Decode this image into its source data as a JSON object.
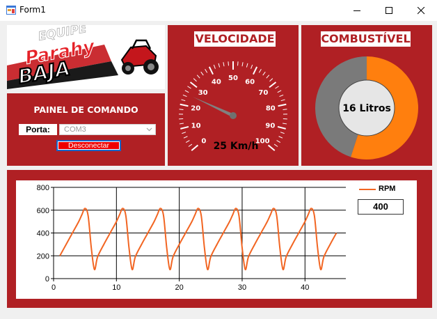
{
  "window": {
    "title": "Form1"
  },
  "logo": {
    "text_top": "EQUIPE",
    "text_main": "Parahy",
    "text_bottom": "BAJA"
  },
  "command_panel": {
    "title": "PAINEL DE COMANDO",
    "port_label": "Porta:",
    "port_value": "COM3",
    "disconnect_label": "Desconectar"
  },
  "speed_panel": {
    "title": "VELOCIDADE",
    "readout": "25 Km/h",
    "value": 25,
    "min": 0,
    "max": 100,
    "ticks": [
      "0",
      "10",
      "20",
      "30",
      "40",
      "50",
      "60",
      "70",
      "80",
      "90",
      "100"
    ]
  },
  "fuel_panel": {
    "title": "COMBUSTÍVEL",
    "readout": "16 Litros",
    "fill_fraction": 0.55,
    "fill_color": "#ff7f0e",
    "empty_color": "#7a7a7a"
  },
  "rpm_display": {
    "legend": "RPM",
    "value": "400",
    "color": "#f26522"
  },
  "chart_data": {
    "type": "line",
    "series": [
      {
        "name": "RPM",
        "x": [
          1,
          2,
          3,
          4,
          4.5,
          5,
          5.5,
          6,
          6.5,
          7,
          8,
          9,
          10,
          10.5,
          11,
          11.5,
          12,
          12.5,
          13,
          14,
          15,
          16,
          16.5,
          17,
          17.5,
          18,
          18.5,
          19,
          20,
          21,
          22,
          22.5,
          23,
          23.5,
          24,
          24.5,
          25,
          26,
          27,
          28,
          28.5,
          29,
          29.5,
          30,
          30.5,
          31,
          32,
          33,
          34,
          34.5,
          35,
          35.5,
          36,
          36.5,
          37,
          38,
          39,
          40,
          40.5,
          41,
          41.5,
          42,
          42.5,
          43,
          44,
          45
        ],
        "values": [
          200,
          300,
          400,
          500,
          560,
          615,
          550,
          270,
          80,
          190,
          300,
          400,
          500,
          560,
          615,
          550,
          270,
          80,
          190,
          300,
          400,
          500,
          560,
          615,
          550,
          270,
          80,
          190,
          300,
          400,
          500,
          560,
          615,
          550,
          270,
          80,
          190,
          300,
          400,
          500,
          560,
          615,
          550,
          270,
          80,
          190,
          300,
          400,
          500,
          560,
          615,
          550,
          270,
          80,
          190,
          300,
          400,
          500,
          560,
          615,
          550,
          270,
          80,
          190,
          300,
          400
        ]
      }
    ],
    "xlim": [
      0,
      46.5
    ],
    "ylim": [
      0,
      800
    ],
    "xticks": [
      0,
      10,
      20,
      30,
      40
    ],
    "yticks": [
      0,
      200,
      400,
      600,
      800
    ],
    "grid": true,
    "legend": "right"
  }
}
